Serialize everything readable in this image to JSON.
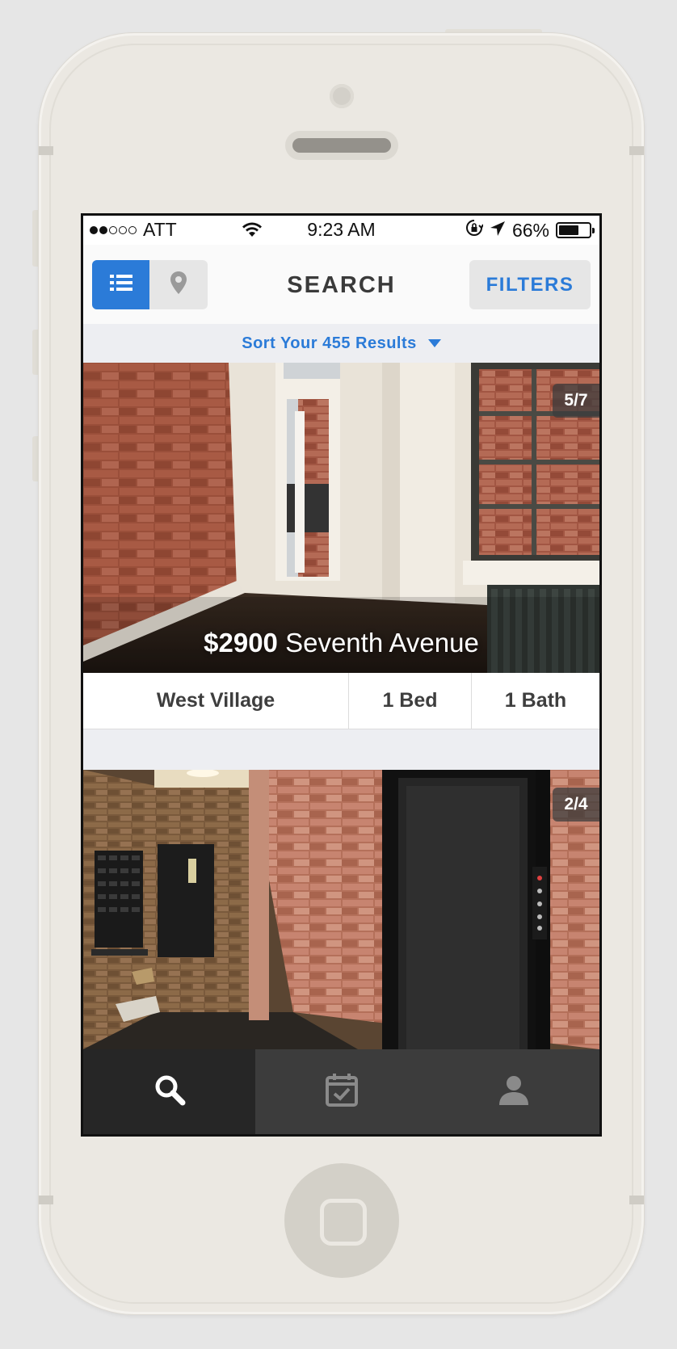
{
  "status_bar": {
    "carrier": "ATT",
    "signal_strength": 2,
    "signal_max": 5,
    "time": "9:23 AM",
    "battery": "66%",
    "battery_level": 0.66
  },
  "nav": {
    "title": "SEARCH",
    "filters_label": "FILTERS",
    "active_view": "list"
  },
  "sort": {
    "label": "Sort Your 455 Results"
  },
  "listings": [
    {
      "photo_counter": "5/7",
      "price": "$2900",
      "street": "Seventh Avenue",
      "neighborhood": "West Village",
      "beds": "1 Bed",
      "baths": "1 Bath"
    },
    {
      "photo_counter": "2/4"
    }
  ],
  "tabs": [
    "search",
    "calendar",
    "profile"
  ],
  "active_tab": "search",
  "colors": {
    "accent": "#2b7bd8",
    "tab_bar": "#3c3c3c",
    "tab_active": "#262626",
    "phone_body": "#ebe8e2"
  }
}
